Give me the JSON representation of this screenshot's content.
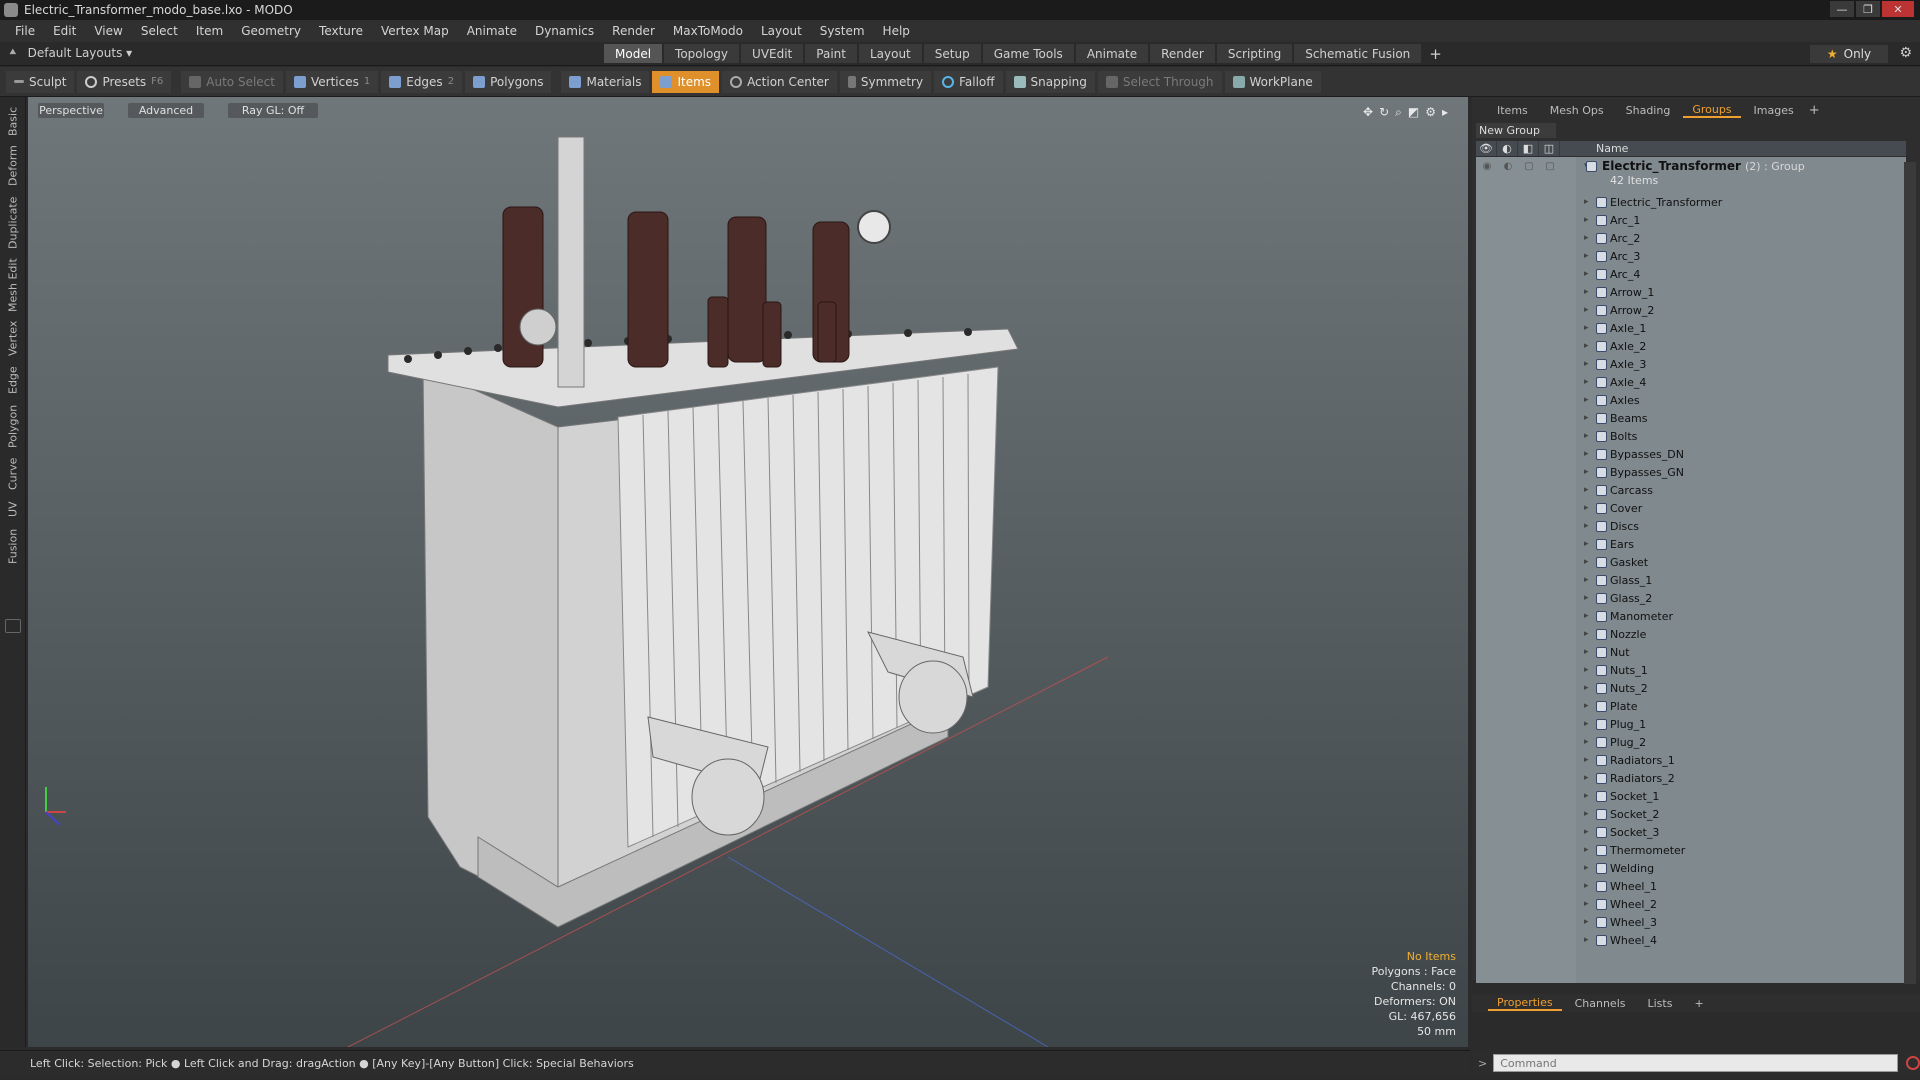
{
  "window": {
    "title": "Electric_Transformer_modo_base.lxo - MODO"
  },
  "menu": [
    "File",
    "Edit",
    "View",
    "Select",
    "Item",
    "Geometry",
    "Texture",
    "Vertex Map",
    "Animate",
    "Dynamics",
    "Render",
    "MaxToModo",
    "Layout",
    "System",
    "Help"
  ],
  "layout": {
    "preset": "Default Layouts ▾",
    "tabs": [
      "Model",
      "Topology",
      "UVEdit",
      "Paint",
      "Layout",
      "Setup",
      "Game Tools",
      "Animate",
      "Render",
      "Scripting",
      "Schematic Fusion"
    ],
    "active_tab": "Model",
    "only_label": "Only"
  },
  "toolbar": {
    "sculpt": "Sculpt",
    "presets": "Presets",
    "presets_key": "F6",
    "auto_select": "Auto Select",
    "vertices": "Vertices",
    "vertices_count": "1",
    "edges": "Edges",
    "edges_count": "2",
    "polygons": "Polygons",
    "materials": "Materials",
    "items": "Items",
    "action_center": "Action Center",
    "symmetry": "Symmetry",
    "falloff": "Falloff",
    "snapping": "Snapping",
    "select_through": "Select Through",
    "workplane": "WorkPlane"
  },
  "left_tabs": [
    "Basic",
    "Deform",
    "Duplicate",
    "Mesh Edit",
    "Vertex",
    "Edge",
    "Polygon",
    "Curve",
    "UV",
    "Fusion"
  ],
  "viewport": {
    "view_mode": "Perspective",
    "shading": "Advanced",
    "raygl": "Ray GL: Off",
    "info": {
      "selection": "No Items",
      "polygons": "Polygons : Face",
      "channels": "Channels: 0",
      "deformers": "Deformers: ON",
      "gl": "GL: 467,656",
      "scale": "50 mm"
    }
  },
  "status": {
    "hint": "Left Click: Selection: Pick ● Left Click and Drag: dragAction ● [Any Key]-[Any Button] Click: Special Behaviors"
  },
  "panel": {
    "tabs": [
      "Items",
      "Mesh Ops",
      "Shading",
      "Groups",
      "Images"
    ],
    "active_tab": "Groups",
    "new_group": "New Group",
    "name_header": "Name",
    "group": {
      "name": "Electric_Transformer",
      "meta": "(2) : Group",
      "count": "42 Items"
    },
    "items": [
      "Electric_Transformer",
      "Arc_1",
      "Arc_2",
      "Arc_3",
      "Arc_4",
      "Arrow_1",
      "Arrow_2",
      "Axle_1",
      "Axle_2",
      "Axle_3",
      "Axle_4",
      "Axles",
      "Beams",
      "Bolts",
      "Bypasses_DN",
      "Bypasses_GN",
      "Carcass",
      "Cover",
      "Discs",
      "Ears",
      "Gasket",
      "Glass_1",
      "Glass_2",
      "Manometer",
      "Nozzle",
      "Nut",
      "Nuts_1",
      "Nuts_2",
      "Plate",
      "Plug_1",
      "Plug_2",
      "Radiators_1",
      "Radiators_2",
      "Socket_1",
      "Socket_2",
      "Socket_3",
      "Thermometer",
      "Welding",
      "Wheel_1",
      "Wheel_2",
      "Wheel_3",
      "Wheel_4"
    ]
  },
  "bottom_panel": {
    "tabs": [
      "Properties",
      "Channels",
      "Lists"
    ],
    "active_tab": "Properties"
  },
  "command": {
    "placeholder": "Command"
  }
}
